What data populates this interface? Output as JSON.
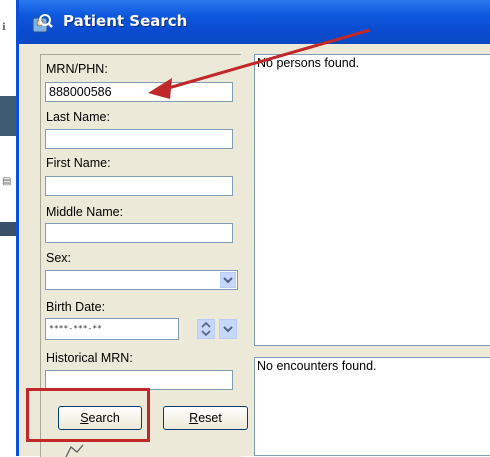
{
  "window": {
    "title": "Patient Search"
  },
  "form": {
    "mrn_label": "MRN/PHN:",
    "mrn_value": "888000586",
    "last_name_label": "Last Name:",
    "last_name_value": "",
    "first_name_label": "First Name:",
    "first_name_value": "",
    "middle_name_label": "Middle Name:",
    "middle_name_value": "",
    "sex_label": "Sex:",
    "sex_value": "",
    "birth_date_label": "Birth Date:",
    "birth_date_value": "****-***-**",
    "historical_mrn_label": "Historical MRN:",
    "historical_mrn_value": "",
    "search_button": {
      "prefix": "",
      "underline": "S",
      "rest": "earch"
    },
    "reset_button": {
      "prefix": "",
      "underline": "R",
      "rest": "eset"
    }
  },
  "results": {
    "persons_text": "No persons found.",
    "encounters_text": "No encounters found."
  },
  "colors": {
    "titlebar": "#0d58dc",
    "annotation": "#c0282a"
  },
  "icons": [
    "patient-search-icon",
    "chevron-down-icon",
    "spin-updown-icon",
    "red-arrow-annotation",
    "red-highlight-box"
  ]
}
